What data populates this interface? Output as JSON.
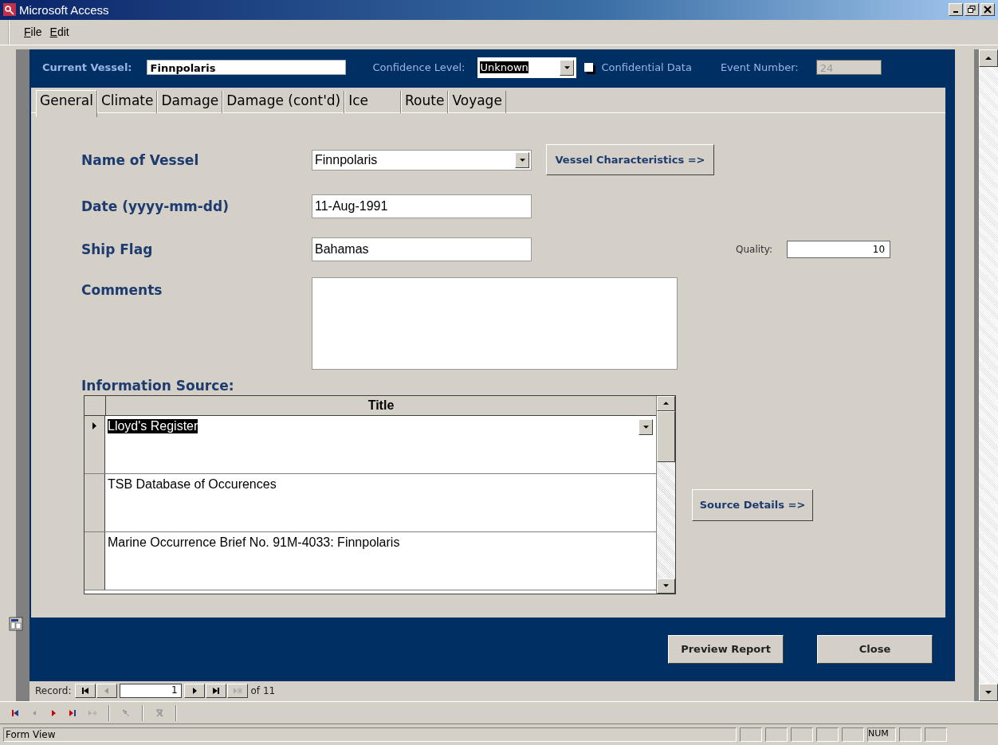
{
  "window": {
    "title": "Microsoft Access"
  },
  "menu": [
    {
      "label": "File"
    },
    {
      "label": "Edit"
    }
  ],
  "header": {
    "current_vessel": {
      "label": "Current Vessel:",
      "value": "Finnpolaris"
    },
    "confidence_level": {
      "label": "Confidence Level:",
      "value": "Unknown"
    },
    "confidential_data": {
      "label": "Confidential Data",
      "checked": false
    },
    "event_number": {
      "label": "Event Number:",
      "value": "24",
      "disabled": true
    }
  },
  "tabs": [
    {
      "label": "General",
      "selected": true
    },
    {
      "label": "Climate",
      "selected": false
    },
    {
      "label": "Damage",
      "selected": false
    },
    {
      "label": "Damage (cont'd)",
      "selected": false
    },
    {
      "label": "Ice",
      "selected": false
    },
    {
      "label": "Route",
      "selected": false
    },
    {
      "label": "Voyage",
      "selected": false
    }
  ],
  "general": {
    "name_of_vessel": {
      "label": "Name of Vessel",
      "value": "Finnpolaris"
    },
    "vessel_characteristics_button": "Vessel Characteristics =>",
    "date": {
      "label": "Date (yyyy-mm-dd)",
      "value": "11-Aug-1991"
    },
    "ship_flag": {
      "label": "Ship Flag",
      "value": "Bahamas"
    },
    "quality": {
      "label": "Quality:",
      "value": "10"
    },
    "comments": {
      "label": "Comments"
    },
    "information_source": {
      "label": "Information Source:",
      "columns": [
        "Title"
      ],
      "rows": [
        {
          "title": "Lloyd's Register",
          "selected": true
        },
        {
          "title": "TSB Database of Occurences",
          "selected": false
        },
        {
          "title": "Marine Occurrence Brief No.  91M-4033: Finnpolaris",
          "selected": false
        }
      ]
    },
    "source_details_button": "Source Details =>"
  },
  "buttons": [
    "Preview Report",
    "Close"
  ],
  "record_navigator": {
    "label": "Record:",
    "value": "1",
    "total": "of 11"
  },
  "status_bar": {
    "text": "Form View",
    "indicator": "NUM"
  }
}
